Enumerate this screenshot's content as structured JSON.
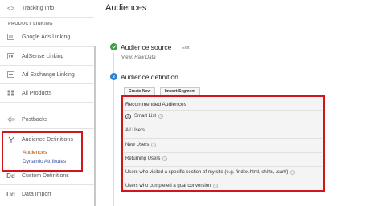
{
  "sidebar": {
    "tracking_info": "Tracking Info",
    "section_header": "PRODUCT LINKING",
    "links": [
      {
        "label": "Google Ads Linking",
        "icon": "google-ads-link-icon"
      },
      {
        "label": "AdSense Linking",
        "icon": "adsense-link-icon"
      },
      {
        "label": "Ad Exchange Linking",
        "icon": "ad-exchange-link-icon"
      },
      {
        "label": "All Products",
        "icon": "all-products-icon"
      }
    ],
    "postbacks": "Postbacks",
    "audience_definitions": "Audience Definitions",
    "sub_items": [
      {
        "label": "Audiences",
        "active": true
      },
      {
        "label": "Dynamic Attributes",
        "active": false
      }
    ],
    "custom_definitions": "Custom Definitions",
    "data_import": "Data Import",
    "dd_icon_text": "Dd"
  },
  "main": {
    "title": "Audiences",
    "step1": {
      "title": "Audience source",
      "edit": "Edit",
      "view_label": "View:",
      "view_value": "Raw Data"
    },
    "step2": {
      "number": "2",
      "title": "Audience definition",
      "buttons": [
        "Create New",
        "Import Segment"
      ]
    },
    "recommended": {
      "header": "Recommended Audiences",
      "items": [
        {
          "label": "Smart List",
          "help": true,
          "smart": true
        },
        {
          "label": "All Users",
          "help": false
        },
        {
          "label": "New Users",
          "help": true
        },
        {
          "label": "Returning Users",
          "help": true
        },
        {
          "label": "Users who visited a specific section of my site (e.g. /index.html, shirts, /cart/)",
          "help": true
        },
        {
          "label": "Users who completed a goal conversion",
          "help": true
        }
      ]
    }
  },
  "colors": {
    "highlight_red": "#d1151b",
    "active_orange": "#b94a00",
    "link_blue": "#3a54a4",
    "step_done_green": "#3c9d3c",
    "step_current_blue": "#2a80d2"
  }
}
